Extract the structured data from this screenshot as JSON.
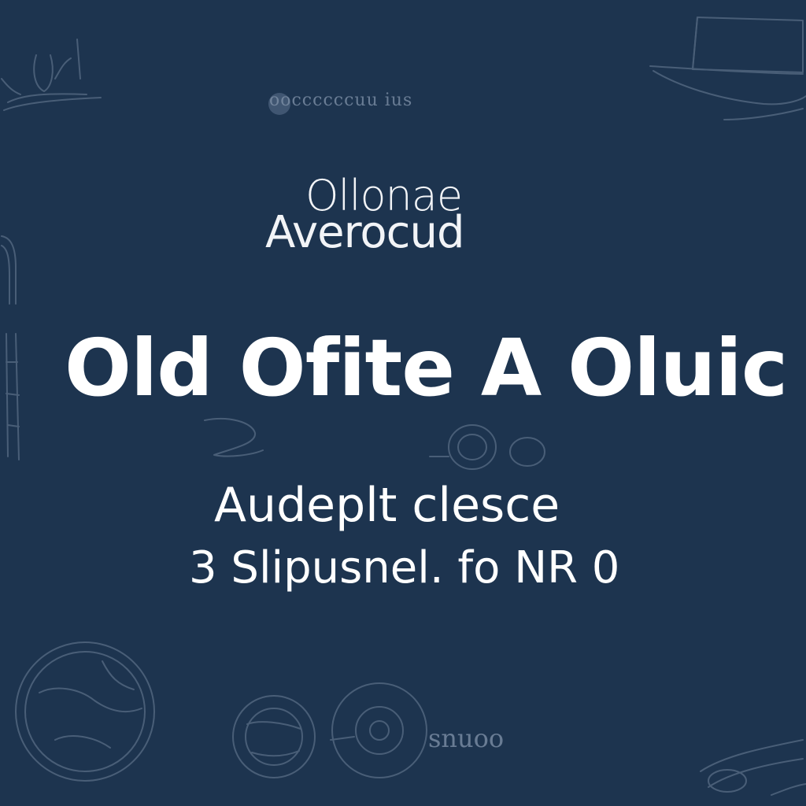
{
  "caption_top": "ooccccccuu  ius",
  "title_lines": [
    "Ollonae",
    "Averocud"
  ],
  "headline": "Old Ofite A Oluic",
  "subtitle_lines": [
    "Audeplt clesce",
    "3 Slipusnel. fo NR 0"
  ],
  "caption_bottom": "snuoo",
  "sketch_icons": [
    "pen-sketch-icon",
    "hat-sketch-icon",
    "arch-sketch-icon",
    "column-sketch-icon",
    "ring-sketch-icon",
    "swirl-sketch-icon",
    "globe-sketch-icon",
    "compass-sketch-icon",
    "medallion-sketch-icon",
    "scroll-sketch-icon"
  ],
  "colors": {
    "background": "#1d344f",
    "text": "#ffffff",
    "sketch": "#6e8199"
  }
}
